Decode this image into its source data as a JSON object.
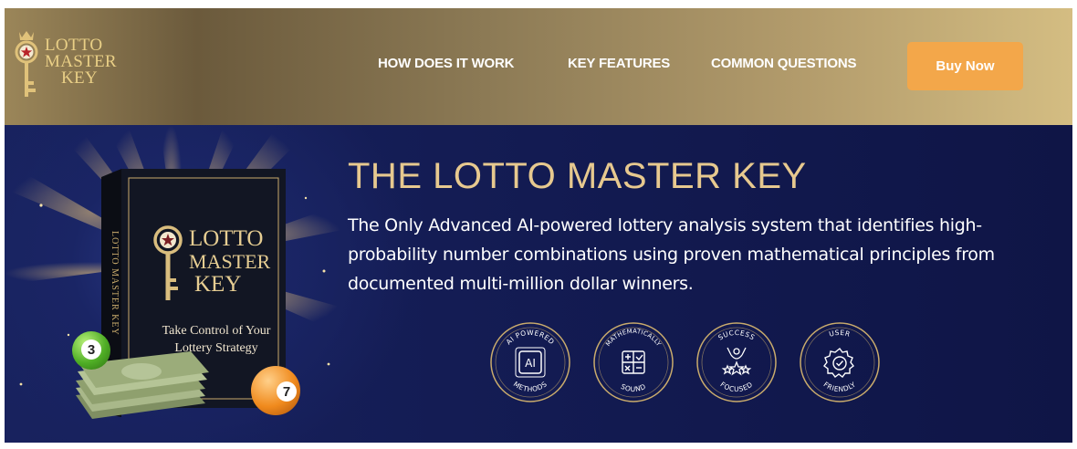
{
  "header": {
    "logo": {
      "line1": "LOTTO",
      "line2": "MASTER",
      "line3": "KEY"
    },
    "nav": [
      {
        "label": "HOW DOES IT WORK"
      },
      {
        "label": "KEY FEATURES"
      },
      {
        "label": "COMMON QUESTIONS"
      }
    ],
    "buy_label": "Buy Now"
  },
  "hero": {
    "title": "THE LOTTO MASTER KEY",
    "description": "The Only Advanced AI-powered lottery analysis system that identifies high-probability number combinations using proven mathematical principles from documented multi-million dollar winners.",
    "book": {
      "spine": "LOTTO MASTER KEY",
      "title1": "LOTTO",
      "title2": "MASTER",
      "title3": "KEY",
      "subtitle1": "Take Control of Your",
      "subtitle2": "Lottery Strategy"
    },
    "balls": {
      "green": "3",
      "orange": "7"
    },
    "badges": [
      {
        "top": "AI POWERED",
        "bottom": "METHODS",
        "icon": "ai-chip-icon",
        "glyph": "AI"
      },
      {
        "top": "MATHEMATICALLY",
        "bottom": "SOUND",
        "icon": "calculator-icon"
      },
      {
        "top": "SUCCESS",
        "bottom": "FOCUSED",
        "icon": "trophy-stars-icon"
      },
      {
        "top": "USER",
        "bottom": "FRIENDLY",
        "icon": "gear-check-icon"
      }
    ]
  },
  "colors": {
    "gold": "#e7c98f",
    "button": "#f3a74a",
    "navy": "#131b52"
  }
}
